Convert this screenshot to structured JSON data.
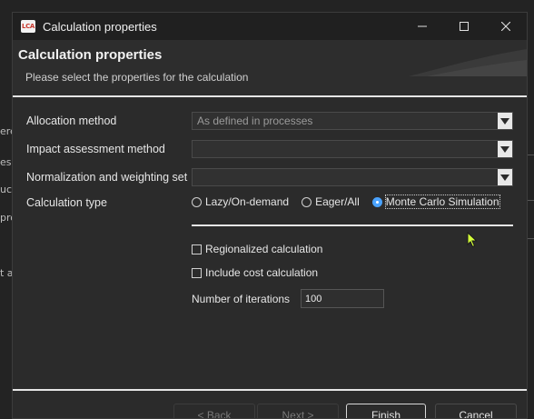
{
  "background": {
    "fragments": [
      "ere",
      "ess",
      "uct",
      "pro",
      "t ar"
    ]
  },
  "window": {
    "title": "Calculation properties",
    "icon_text": "LCA",
    "controls": [
      "minimize-icon",
      "maximize-icon",
      "close-icon"
    ]
  },
  "banner": {
    "title": "Calculation properties",
    "subtitle": "Please select the properties for the calculation"
  },
  "form": {
    "allocation_label": "Allocation method",
    "allocation_value": "As defined in processes",
    "impact_label": "Impact assessment method",
    "impact_value": "",
    "nw_label": "Normalization and weighting set",
    "nw_value": "",
    "calc_type_label": "Calculation type",
    "calc_types": [
      {
        "label": "Lazy/On-demand",
        "checked": false
      },
      {
        "label": "Eager/All",
        "checked": false
      },
      {
        "label": "Monte Carlo Simulation",
        "checked": true
      }
    ],
    "regionalized_label": "Regionalized calculation",
    "regionalized_checked": false,
    "cost_label": "Include cost calculation",
    "cost_checked": false,
    "iterations_label": "Number of iterations",
    "iterations_value": "100"
  },
  "buttons": {
    "back": "< Back",
    "next": "Next >",
    "finish": "Finish",
    "cancel": "Cancel"
  },
  "colors": {
    "accent": "#4aa3ff",
    "dialog_bg": "#2b2b2b",
    "titlebar_bg": "#202020"
  }
}
